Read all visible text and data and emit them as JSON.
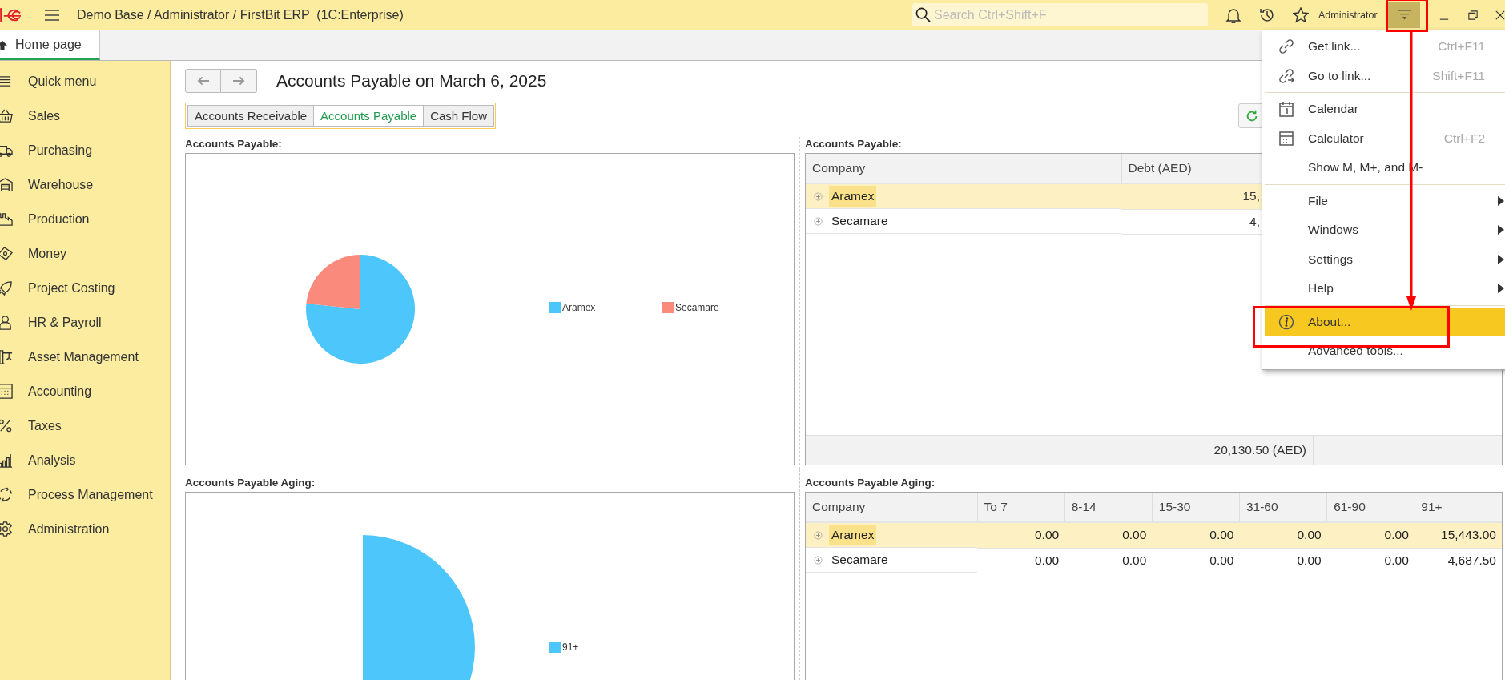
{
  "top_bar": {
    "app_title": "Demo Base / Administrator / FirstBit ERP  (1C:Enterprise)",
    "search": {
      "placeholder": "Search Ctrl+Shift+F"
    },
    "user": "Administrator"
  },
  "open_tabs": [
    {
      "label": "Home page",
      "selected": true
    }
  ],
  "sidebar": {
    "items": [
      {
        "label": "Quick menu"
      },
      {
        "label": "Sales"
      },
      {
        "label": "Purchasing"
      },
      {
        "label": "Warehouse"
      },
      {
        "label": "Production"
      },
      {
        "label": "Money"
      },
      {
        "label": "Project Costing"
      },
      {
        "label": "HR & Payroll"
      },
      {
        "label": "Asset Management"
      },
      {
        "label": "Accounting"
      },
      {
        "label": "Taxes"
      },
      {
        "label": "Analysis"
      },
      {
        "label": "Process Management"
      },
      {
        "label": "Administration"
      }
    ]
  },
  "page": {
    "title": "Accounts Payable on March 6, 2025",
    "tabs": [
      {
        "label": "Accounts Receivable",
        "selected": false
      },
      {
        "label": "Accounts Payable",
        "selected": true
      },
      {
        "label": "Cash Flow",
        "selected": false
      }
    ],
    "payable_chart": {
      "title": "Accounts Payable:",
      "legend": [
        {
          "label": "Aramex",
          "color": "#4dc7fb"
        },
        {
          "label": "Secamare",
          "color": "#fa8a7b"
        }
      ]
    },
    "payable_table": {
      "title": "Accounts Payable:",
      "columns": [
        "Company",
        "Debt (AED)"
      ],
      "rows": [
        {
          "company": "Aramex",
          "debt": "15,",
          "selected": true
        },
        {
          "company": "Secamare",
          "debt": "4,",
          "selected": false
        }
      ],
      "footer": "20,130.50 (AED)"
    },
    "aging_chart": {
      "title": "Accounts Payable Aging:",
      "legend": [
        {
          "label": "91+",
          "color": "#4dc7fb"
        }
      ]
    },
    "aging_table": {
      "title": "Accounts Payable Aging:",
      "columns": [
        "Company",
        "To 7",
        "8-14",
        "15-30",
        "31-60",
        "61-90",
        "91+"
      ],
      "rows": [
        {
          "cells": [
            "Aramex",
            "0.00",
            "0.00",
            "0.00",
            "0.00",
            "0.00",
            "15,443.00"
          ],
          "selected": true
        },
        {
          "cells": [
            "Secamare",
            "0.00",
            "0.00",
            "0.00",
            "0.00",
            "0.00",
            "4,687.50"
          ],
          "selected": false
        }
      ]
    }
  },
  "menu": {
    "groups": [
      [
        {
          "label": "Get link...",
          "shortcut": "Ctrl+F11",
          "submenu": false,
          "selected": false
        },
        {
          "label": "Go to link...",
          "shortcut": "Shift+F11",
          "submenu": false,
          "selected": false
        }
      ],
      [
        {
          "label": "Calendar",
          "submenu": false,
          "selected": false
        },
        {
          "label": "Calculator",
          "shortcut": "Ctrl+F2",
          "submenu": false,
          "selected": false
        },
        {
          "label": "Show M, M+, and M-",
          "submenu": false,
          "selected": false
        }
      ],
      [
        {
          "label": "File",
          "submenu": true,
          "selected": false
        },
        {
          "label": "Windows",
          "submenu": true,
          "selected": false
        },
        {
          "label": "Settings",
          "submenu": true,
          "selected": false
        },
        {
          "label": "Help",
          "submenu": true,
          "selected": false
        }
      ],
      [
        {
          "label": "About...",
          "submenu": false,
          "selected": true
        },
        {
          "label": "Advanced tools...",
          "submenu": false,
          "selected": false
        }
      ]
    ]
  }
}
